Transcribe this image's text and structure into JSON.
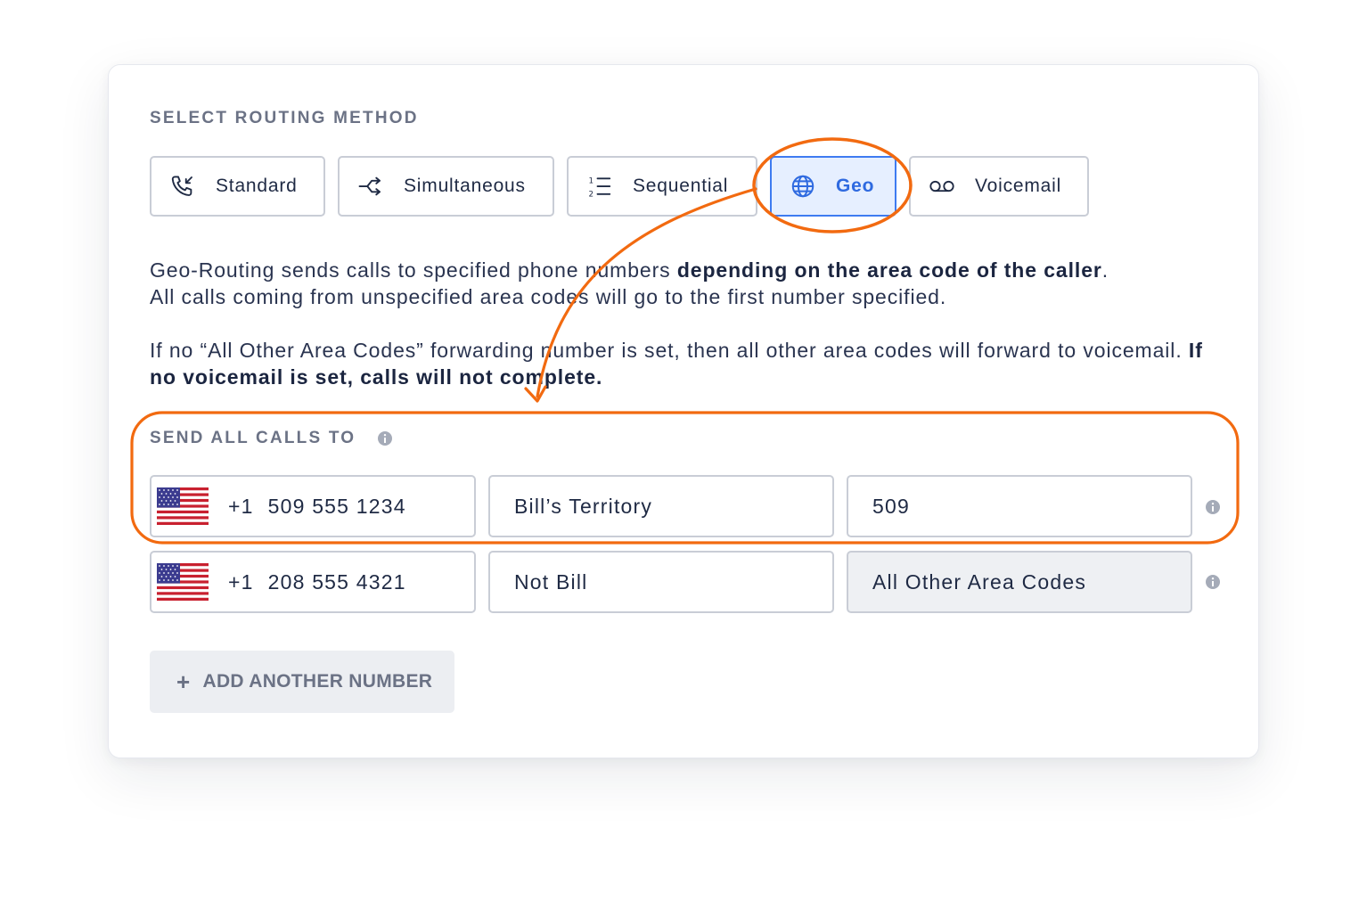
{
  "routing": {
    "section_label": "SELECT ROUTING METHOD",
    "methods": [
      {
        "label": "Standard",
        "icon": "phone-incoming-icon"
      },
      {
        "label": "Simultaneous",
        "icon": "split-arrows-icon"
      },
      {
        "label": "Sequential",
        "icon": "ordered-list-icon"
      },
      {
        "label": "Geo",
        "icon": "globe-icon",
        "active": true
      },
      {
        "label": "Voicemail",
        "icon": "voicemail-icon"
      }
    ]
  },
  "description": {
    "p1_normal": "Geo-Routing sends calls to specified phone numbers ",
    "p1_bold": "depending on the area code of the caller",
    "p1_end": ".",
    "p1_line2": "All calls coming from unspecified area codes will go to the first number specified.",
    "p2_normal": "If no “All Other Area Codes” forwarding number is set, then all other area codes will forward to voicemail. ",
    "p2_bold": "If no voicemail is set, calls will not complete."
  },
  "send_calls": {
    "label": "SEND ALL CALLS TO",
    "rows": [
      {
        "country_code": "+1",
        "number": "509 555 1234",
        "name": "Bill’s Territory",
        "area": "509"
      },
      {
        "country_code": "+1",
        "number": "208 555 4321",
        "name": "Not Bill",
        "area": "All Other Area Codes"
      }
    ],
    "add_label": "ADD ANOTHER NUMBER"
  },
  "colors": {
    "accent": "#3e7bf1",
    "annotation": "#f26a10",
    "text": "#1f2a44",
    "muted": "#6b7285"
  }
}
